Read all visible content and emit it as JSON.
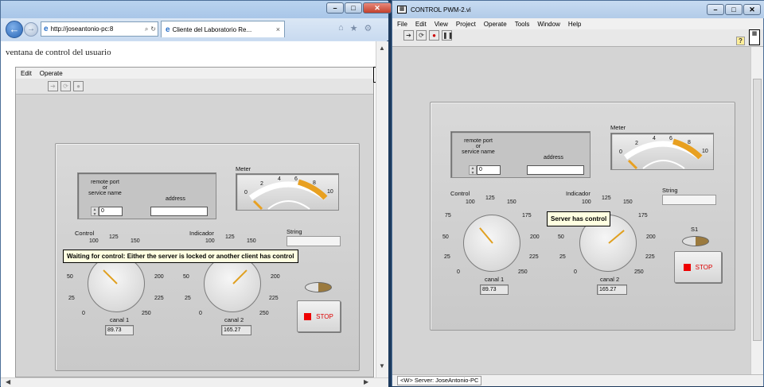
{
  "browser": {
    "url": "http://joseantonio-pc:8",
    "tab_title": "Cliente del Laboratorio Re...",
    "tab_close": "×",
    "heading": "ventana de control del usuario",
    "menu": [
      "Edit",
      "Operate"
    ],
    "tooltip": "Waiting for control: Either the server is locked or another client has control"
  },
  "lv_window": {
    "title": "CONTROL PWM-2.vi",
    "menu": [
      "File",
      "Edit",
      "View",
      "Project",
      "Operate",
      "Tools",
      "Window",
      "Help"
    ],
    "tooltip": "Server has control",
    "status": "<W> Server: JoseAntonio-PC"
  },
  "panel": {
    "remote_port_label": "remote port\nor\nservice name",
    "address_label": "address",
    "port_value": "0",
    "address_value": "",
    "meter_label": "Meter",
    "meter_ticks": [
      "0",
      "2",
      "4",
      "6",
      "8",
      "10"
    ],
    "string_label": "String",
    "string_value": "",
    "control_label": "Control",
    "indicador_label": "Indicador",
    "dial_ticks": [
      "0",
      "25",
      "50",
      "75",
      "100",
      "125",
      "150",
      "175",
      "200",
      "225",
      "250"
    ],
    "canal1_label": "canal 1",
    "canal1_value": "89.73",
    "canal2_label": "canal 2",
    "canal2_value": "165.27",
    "s1_label": "S1",
    "stop_label": "STOP"
  },
  "colors": {
    "accent": "#e8a020",
    "stop_red": "#e00000",
    "tooltip_bg": "#ffffe1"
  },
  "icons": [
    "back-arrow-icon",
    "forward-arrow-icon",
    "ie-icon",
    "search-icon",
    "refresh-icon",
    "home-icon",
    "star-icon",
    "gear-icon",
    "run-arrow-icon",
    "run-continuous-icon",
    "abort-icon",
    "pause-icon",
    "help-icon",
    "vi-icon"
  ]
}
